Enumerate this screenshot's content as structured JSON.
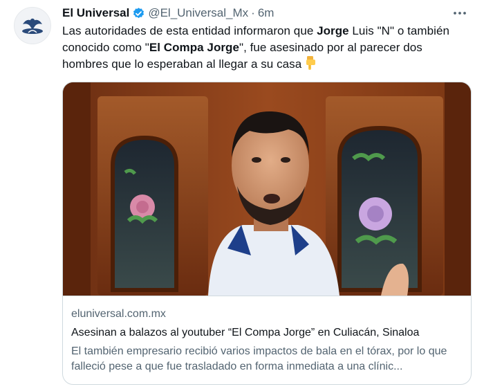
{
  "tweet": {
    "author_name": "El Universal",
    "handle": "@El_Universal_Mx",
    "separator": "·",
    "time": "6m",
    "text": {
      "p1": "Las autoridades de esta entidad informaron que ",
      "b1": "Jorge",
      "p2": " Luis \"N\" o también conocido como \"",
      "b2": "El Compa Jorge",
      "p3": "\", fue asesinado por al parecer dos hombres que lo esperaban al llegar a su casa"
    },
    "emoji_icon": "backhand-index-pointing-down-icon"
  },
  "card": {
    "domain": "eluniversal.com.mx",
    "title": "Asesinan a balazos al youtuber “El Compa Jorge” en Culiacán, Sinaloa",
    "description": "El también empresario recibió varios impactos de bala en el tórax, por lo que falleció pese a que fue trasladado en forma inmediata a una clínic..."
  },
  "icons": {
    "avatar": "eagle-logo-icon",
    "verified": "verified-badge-icon",
    "more": "more-options-icon"
  },
  "colors": {
    "verified_blue": "#1d9bf0",
    "secondary_text": "#536471",
    "primary_text": "#0f1419",
    "border": "#cfd9de",
    "avatar_blue": "#2a4a7a"
  }
}
